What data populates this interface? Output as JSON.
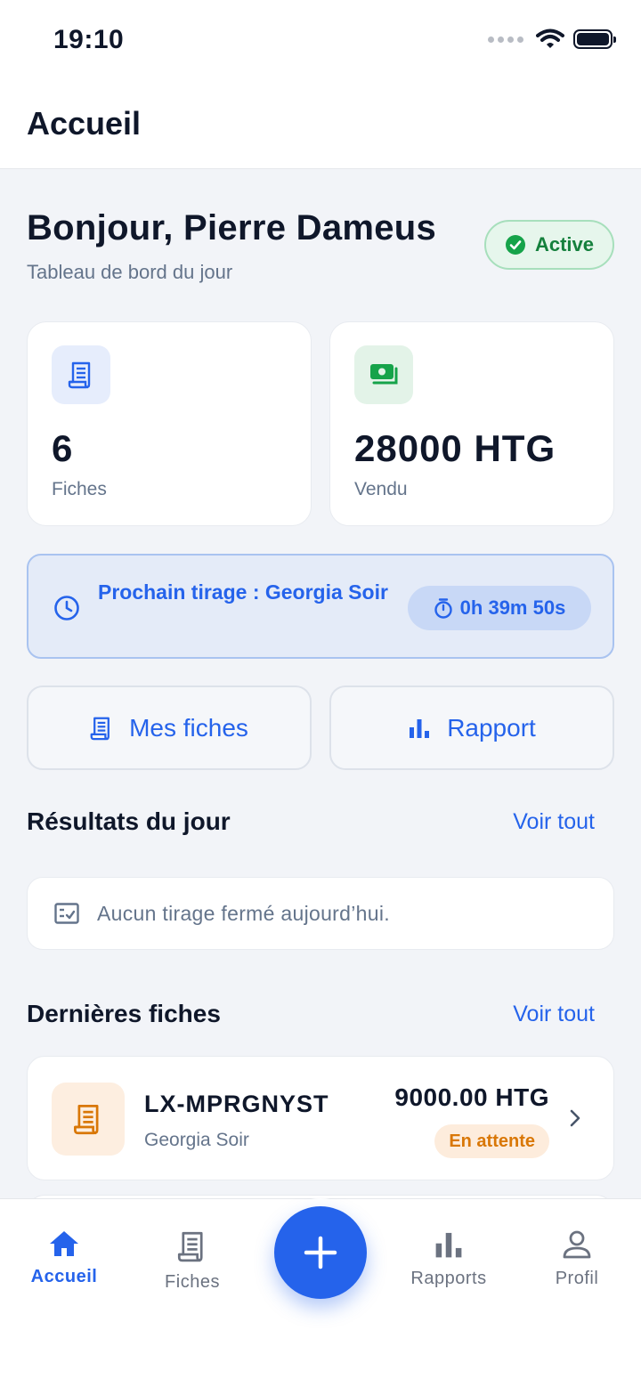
{
  "status_bar": {
    "time": "19:10"
  },
  "header": {
    "title": "Accueil"
  },
  "greeting": {
    "title": "Bonjour, Pierre Dameus",
    "subtitle": "Tableau de bord du jour"
  },
  "status_badge": {
    "label": "Active",
    "color": "#15803d"
  },
  "stats": {
    "tickets": {
      "value": "6",
      "label": "Fiches",
      "icon": "receipt-icon"
    },
    "sales": {
      "value": "28000 HTG",
      "label": "Vendu",
      "icon": "cash-icon"
    }
  },
  "next_draw": {
    "label": "Prochain tirage : Georgia Soir",
    "countdown": "0h 39m 50s"
  },
  "actions": {
    "my_tickets": "Mes fiches",
    "report": "Rapport"
  },
  "results": {
    "title": "Résultats du jour",
    "see_all": "Voir tout",
    "empty_text": "Aucun tirage fermé aujourd’hui."
  },
  "latest": {
    "title": "Dernières fiches",
    "see_all": "Voir tout",
    "tickets": [
      {
        "id": "LX-MPRGNYST",
        "draw": "Georgia Soir",
        "amount": "9000.00 HTG",
        "status": "En attente"
      }
    ]
  },
  "tab_bar": {
    "home": "Accueil",
    "tickets": "Fiches",
    "reports": "Rapports",
    "profile": "Profil"
  },
  "colors": {
    "accent": "#2563eb",
    "success": "#15803d",
    "warning": "#d97706"
  }
}
